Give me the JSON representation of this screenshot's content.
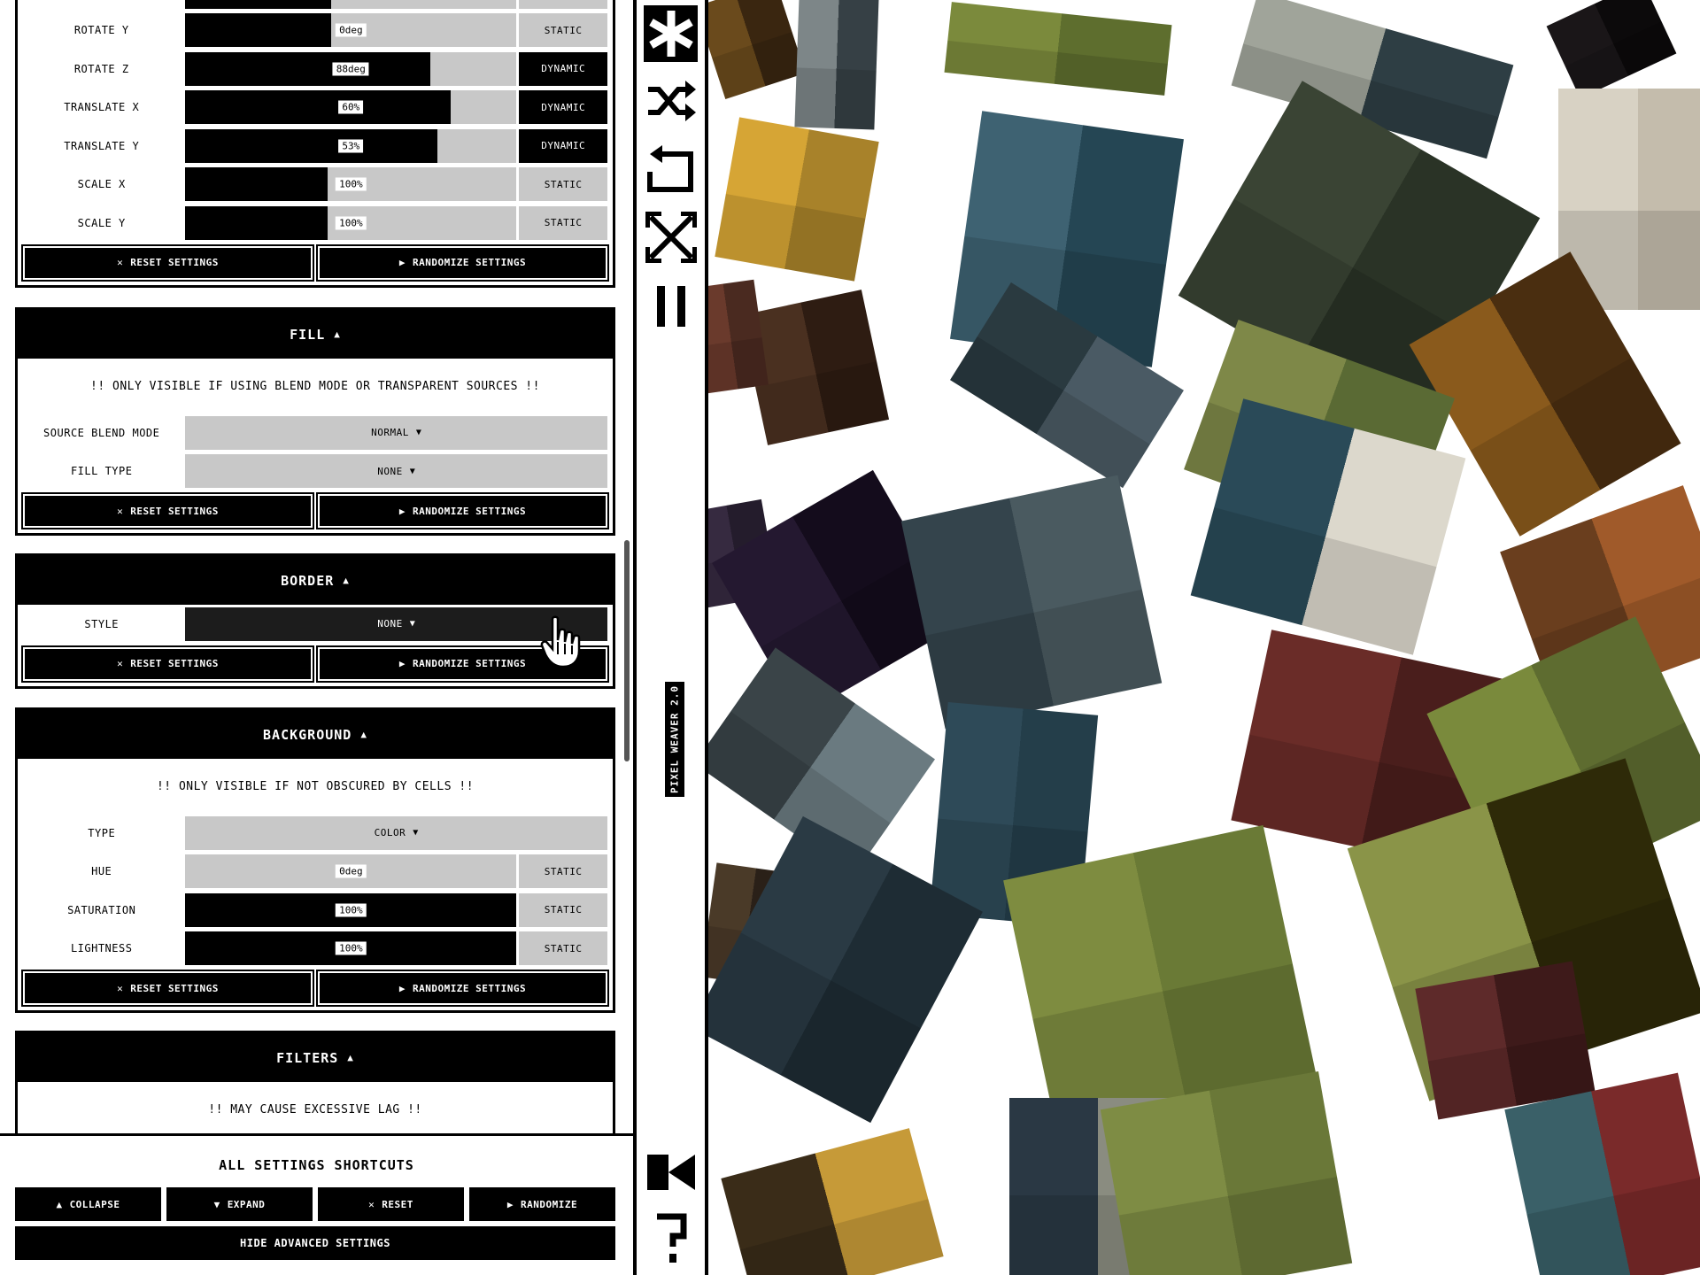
{
  "panel": {
    "transform_section": {
      "rows": [
        {
          "label": "ROTATE Y",
          "value": "0deg",
          "fill_fraction": 0.44,
          "mode": "STATIC"
        },
        {
          "label": "ROTATE Z",
          "value": "88deg",
          "fill_fraction": 0.74,
          "mode": "DYNAMIC"
        },
        {
          "label": "TRANSLATE X",
          "value": "60%",
          "fill_fraction": 0.8,
          "mode": "DYNAMIC"
        },
        {
          "label": "TRANSLATE Y",
          "value": "53%",
          "fill_fraction": 0.76,
          "mode": "DYNAMIC"
        },
        {
          "label": "SCALE X",
          "value": "100%",
          "fill_fraction": 0.43,
          "mode": "STATIC"
        },
        {
          "label": "SCALE Y",
          "value": "100%",
          "fill_fraction": 0.43,
          "mode": "STATIC"
        }
      ],
      "reset_label": "RESET SETTINGS",
      "randomize_label": "RANDOMIZE SETTINGS"
    },
    "fill_section": {
      "title": "FILL",
      "note": "!! ONLY VISIBLE IF USING BLEND MODE OR TRANSPARENT SOURCES !!",
      "source_blend_mode_label": "SOURCE BLEND MODE",
      "source_blend_mode_value": "NORMAL",
      "fill_type_label": "FILL TYPE",
      "fill_type_value": "NONE",
      "reset_label": "RESET SETTINGS",
      "randomize_label": "RANDOMIZE SETTINGS"
    },
    "border_section": {
      "title": "BORDER",
      "style_label": "STYLE",
      "style_value": "NONE",
      "reset_label": "RESET SETTINGS",
      "randomize_label": "RANDOMIZE SETTINGS"
    },
    "background_section": {
      "title": "BACKGROUND",
      "note": "!! ONLY VISIBLE IF NOT OBSCURED BY CELLS !!",
      "type_label": "TYPE",
      "type_value": "COLOR",
      "hue_label": "HUE",
      "hue_value": "0deg",
      "hue_fraction": 0.0,
      "hue_mode": "STATIC",
      "saturation_label": "SATURATION",
      "saturation_value": "100%",
      "saturation_fraction": 1.0,
      "saturation_mode": "STATIC",
      "lightness_label": "LIGHTNESS",
      "lightness_value": "100%",
      "lightness_fraction": 1.0,
      "lightness_mode": "STATIC",
      "reset_label": "RESET SETTINGS",
      "randomize_label": "RANDOMIZE SETTINGS"
    },
    "filters_section": {
      "title": "FILTERS",
      "note": "!! MAY CAUSE EXCESSIVE LAG !!"
    }
  },
  "shortcuts": {
    "title": "ALL SETTINGS SHORTCUTS",
    "collapse_label": "COLLAPSE",
    "expand_label": "EXPAND",
    "reset_label": "RESET",
    "randomize_label": "RANDOMIZE",
    "hide_label": "HIDE ADVANCED SETTINGS"
  },
  "toolbar": {
    "brand": "PIXEL WEAVER 2.0",
    "icons": [
      "asterisk-icon",
      "shuffle-icon",
      "rotate-icon",
      "fullscreen-icon",
      "pause-icon",
      "record-icon",
      "help-icon"
    ]
  },
  "colors": {
    "panel_black": "#000000",
    "control_gray": "#c8c8c8",
    "canvas_bg": "#ffffff"
  }
}
